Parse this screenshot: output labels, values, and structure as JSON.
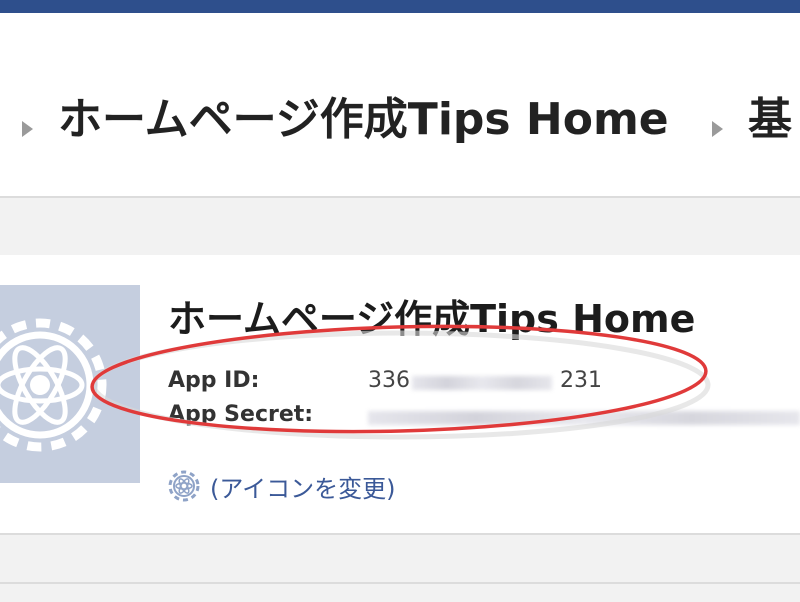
{
  "breadcrumb": {
    "items": [
      "ホームページ作成Tips Home",
      "基"
    ]
  },
  "app": {
    "name": "ホームページ作成Tips Home",
    "app_id_label": "App ID:",
    "app_id_prefix": "336",
    "app_id_suffix": "231",
    "app_secret_label": "App Secret:",
    "change_icon_label": "(アイコンを変更)"
  },
  "colors": {
    "top_bar": "#2e4f8c",
    "link": "#3b5998",
    "highlight": "#e03a3a",
    "icon_tile": "#c5cedf"
  },
  "icons": {
    "app_icon": "atom-gear-icon",
    "change_icon": "gear-icon",
    "breadcrumb_separator": "triangle-right-icon"
  }
}
